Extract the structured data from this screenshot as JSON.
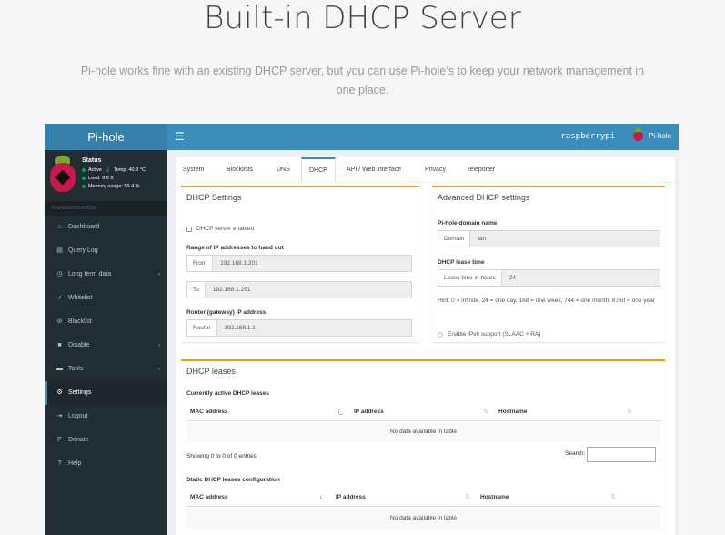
{
  "hero": {
    "title": "Built-in DHCP Server",
    "subtitle": "Pi-hole works fine with an existing DHCP server, but you can use Pi-hole’s to keep your network management in one place."
  },
  "topbar": {
    "logo": "Pi-hole",
    "menu_icon": "☰",
    "hostname": "raspberrypi",
    "user_label": "Pi-hole"
  },
  "status": {
    "title": "Status",
    "active": "Active",
    "temp": "Temp: 40.8 °C",
    "load": "Load: 0 0 0",
    "memory": "Memory usage: 59.4 %"
  },
  "nav": {
    "header": "MAIN NAVIGATION",
    "items": [
      {
        "label": "Dashboard",
        "icon": "home-icon",
        "glyph": "⌂"
      },
      {
        "label": "Query Log",
        "icon": "file-icon",
        "glyph": "▤"
      },
      {
        "label": "Long term data",
        "icon": "clock-icon",
        "glyph": "◷"
      },
      {
        "label": "Whitelist",
        "icon": "check-circle-icon",
        "glyph": "✓"
      },
      {
        "label": "Blacklist",
        "icon": "ban-icon",
        "glyph": "⊘"
      },
      {
        "label": "Disable",
        "icon": "stop-icon",
        "glyph": "■"
      },
      {
        "label": "Tools",
        "icon": "folder-icon",
        "glyph": "▬"
      },
      {
        "label": "Settings",
        "icon": "gears-icon",
        "glyph": "⚙"
      },
      {
        "label": "Logout",
        "icon": "logout-icon",
        "glyph": "⇥"
      },
      {
        "label": "Donate",
        "icon": "paypal-icon",
        "glyph": "P"
      },
      {
        "label": "Help",
        "icon": "question-icon",
        "glyph": "?"
      }
    ],
    "chevron": "‹"
  },
  "tabs": [
    "System",
    "Blocklists",
    "DNS",
    "DHCP",
    "API / Web interface",
    "Privacy",
    "Teleporter"
  ],
  "active_tab": "DHCP",
  "dhcp_settings": {
    "title": "DHCP Settings",
    "server_enabled_label": "DHCP server enabled",
    "range_label": "Range of IP addresses to hand out",
    "from_label": "From",
    "from_value": "192.168.1.201",
    "to_label": "To",
    "to_value": "192.168.1.251",
    "router_heading": "Router (gateway) IP address",
    "router_label": "Router",
    "router_value": "192.168.1.1"
  },
  "advanced": {
    "title": "Advanced DHCP settings",
    "domain_heading": "Pi-hole domain name",
    "domain_label": "Domain",
    "domain_value": "lan",
    "lease_heading": "DHCP lease time",
    "lease_label": "Lease time in hours",
    "lease_value": "24",
    "hint": "Hint: 0 = infinite, 24 = one day, 168 = one week, 744 = one month, 8760 = one year",
    "ipv6_label": "Enable IPv6 support (SLAAC + RA)"
  },
  "leases": {
    "title": "DHCP leases",
    "active_heading": "Currently active DHCP leases",
    "static_heading": "Static DHCP leases configuration",
    "columns": [
      "MAC address",
      "IP address",
      "Hostname"
    ],
    "empty": "No data available in table",
    "info": "Showing 0 to 0 of 0 entries",
    "search_label": "Search:"
  }
}
